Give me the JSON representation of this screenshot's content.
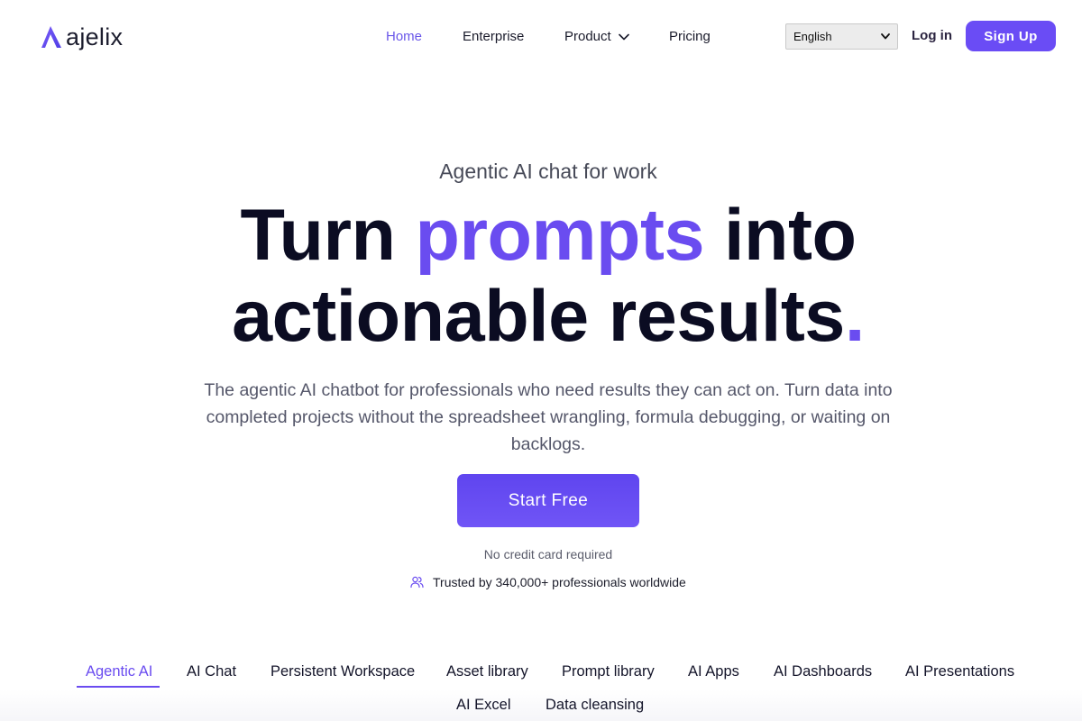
{
  "brand": {
    "logo_text": "ajelix",
    "accent_color": "#6a4cf0"
  },
  "nav": {
    "home": "Home",
    "enterprise": "Enterprise",
    "product": "Product",
    "pricing": "Pricing",
    "active": "Home"
  },
  "language_select": {
    "selected": "English"
  },
  "auth": {
    "login": "Log in",
    "signup": "Sign Up"
  },
  "hero": {
    "eyebrow": "Agentic AI chat for work",
    "headline_part1": "Turn ",
    "headline_accent": "prompts",
    "headline_part2": " into",
    "headline_line2": "actionable results",
    "headline_dot": ".",
    "description": "The agentic AI chatbot for professionals who need results they can act on. Turn data into completed projects without the spreadsheet wrangling, formula debugging, or waiting on backlogs.",
    "cta": "Start Free",
    "no_credit_card": "No credit card required",
    "trusted": "Trusted by 340,000+ professionals worldwide"
  },
  "feature_tabs": {
    "active": "Agentic AI",
    "items": [
      "Agentic AI",
      "AI Chat",
      "Persistent Workspace",
      "Asset library",
      "Prompt library",
      "AI Apps",
      "AI Dashboards",
      "AI Presentations",
      "AI Excel",
      "Data cleansing"
    ]
  },
  "icons": {
    "logo": "ajelix-logo-mark",
    "product_dropdown": "chevron-down-icon",
    "language_dropdown": "chevron-down-icon",
    "trusted": "users-icon"
  }
}
